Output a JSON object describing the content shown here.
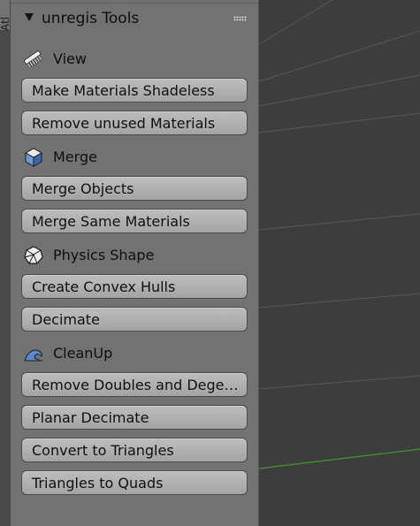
{
  "sidebar_tab": {
    "label": "Atl"
  },
  "panel": {
    "title": "unregis Tools"
  },
  "sections": [
    {
      "label": "View",
      "icon": "comb-icon",
      "buttons": [
        "Make Materials Shadeless",
        "Remove unused Materials"
      ]
    },
    {
      "label": "Merge",
      "icon": "cube-icon",
      "buttons": [
        "Merge Objects",
        "Merge Same Materials"
      ]
    },
    {
      "label": "Physics Shape",
      "icon": "convex-hull-icon",
      "buttons": [
        "Create Convex Hulls",
        "Decimate"
      ]
    },
    {
      "label": "CleanUp",
      "icon": "wave-icon",
      "buttons": [
        "Remove Doubles and Dege…",
        "Planar Decimate",
        "Convert to Triangles",
        "Triangles to Quads"
      ]
    }
  ],
  "colors": {
    "viewport_bg": "#3d3d3d",
    "panel_bg": "#727272",
    "button_bg": "#b0b0b0",
    "grid_line": "#5a5a5a",
    "axis_line": "#3f9a2e",
    "cube_icon": "#5680c2"
  }
}
